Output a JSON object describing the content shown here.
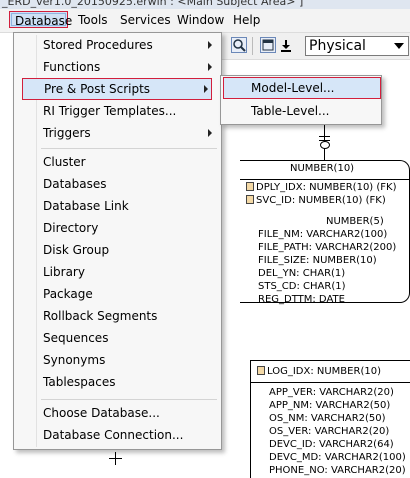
{
  "window": {
    "title": "_ERD_ver1.0_20150925.erwin : <Main Subject Area> ]"
  },
  "menubar": {
    "items": [
      {
        "label": "Database",
        "active": true
      },
      {
        "label": "Tools"
      },
      {
        "label": "Services"
      },
      {
        "label": "Window"
      },
      {
        "label": "Help"
      }
    ]
  },
  "toolbar": {
    "view_mode_value": "Physical"
  },
  "database_menu": {
    "items": [
      {
        "label": "Stored Procedures",
        "submenu": true
      },
      {
        "label": "Functions",
        "submenu": true
      },
      {
        "label": "Pre & Post Scripts",
        "submenu": true,
        "highlighted": true
      },
      {
        "label": "RI Trigger Templates..."
      },
      {
        "label": "Triggers",
        "submenu": true
      },
      {
        "label": "Cluster"
      },
      {
        "label": "Databases"
      },
      {
        "label": "Database Link"
      },
      {
        "label": "Directory"
      },
      {
        "label": "Disk Group"
      },
      {
        "label": "Library"
      },
      {
        "label": "Package"
      },
      {
        "label": "Rollback Segments"
      },
      {
        "label": "Sequences"
      },
      {
        "label": "Synonyms"
      },
      {
        "label": "Tablespaces"
      },
      {
        "label": "Choose Database..."
      },
      {
        "label": "Database Connection..."
      }
    ]
  },
  "scripts_submenu": {
    "items": [
      {
        "label": "Model-Level...",
        "highlighted": true
      },
      {
        "label": "Table-Level..."
      }
    ]
  },
  "diagram": {
    "entity1": {
      "partial_header": "NUMBER(10)",
      "fk_rows": [
        "DPLY_IDX: NUMBER(10) (FK)",
        "SVC_ID: NUMBER(10) (FK)"
      ],
      "partial_row": "NUMBER(5)",
      "rows": [
        "FILE_NM: VARCHAR2(100)",
        "FILE_PATH: VARCHAR2(200)",
        "FILE_SIZE: NUMBER(10)",
        "DEL_YN: CHAR(1)",
        "STS_CD: CHAR(1)",
        "REG_DTTM: DATE"
      ]
    },
    "entity2": {
      "pk_row": "LOG_IDX: NUMBER(10)",
      "rows": [
        "APP_VER: VARCHAR2(20)",
        "APP_NM: VARCHAR2(50)",
        "OS_NM: VARCHAR2(50)",
        "OS_VER: VARCHAR2(20)",
        "DEVC_ID: VARCHAR2(64)",
        "DEVC_MD: VARCHAR2(100)",
        "PHONE_NO: VARCHAR2(20)"
      ]
    }
  },
  "colors": {
    "highlight_border": "#d21f3c",
    "highlight_fill": "#d6e6f8",
    "menu_bg": "#f7f7f7"
  }
}
